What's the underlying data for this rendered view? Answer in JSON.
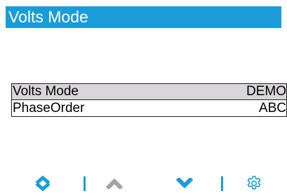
{
  "title": "Volts Mode",
  "menu": {
    "items": [
      {
        "label": "Volts Mode",
        "value": "DEMO",
        "selected": true
      },
      {
        "label": "PhaseOrder",
        "value": "ABC",
        "selected": false
      }
    ]
  },
  "toolbar": {
    "buttons": [
      {
        "name": "up-down-icon",
        "color": "#1a9cd8"
      },
      {
        "name": "up-icon",
        "color": "#a3a3a3"
      },
      {
        "name": "down-icon",
        "color": "#1a9cd8"
      },
      {
        "name": "gear-icon",
        "color": "#1a9cd8"
      }
    ]
  },
  "colors": {
    "accent": "#1a9cd8",
    "selected_row": "#d9d6d9",
    "disabled_icon": "#a3a3a3"
  }
}
